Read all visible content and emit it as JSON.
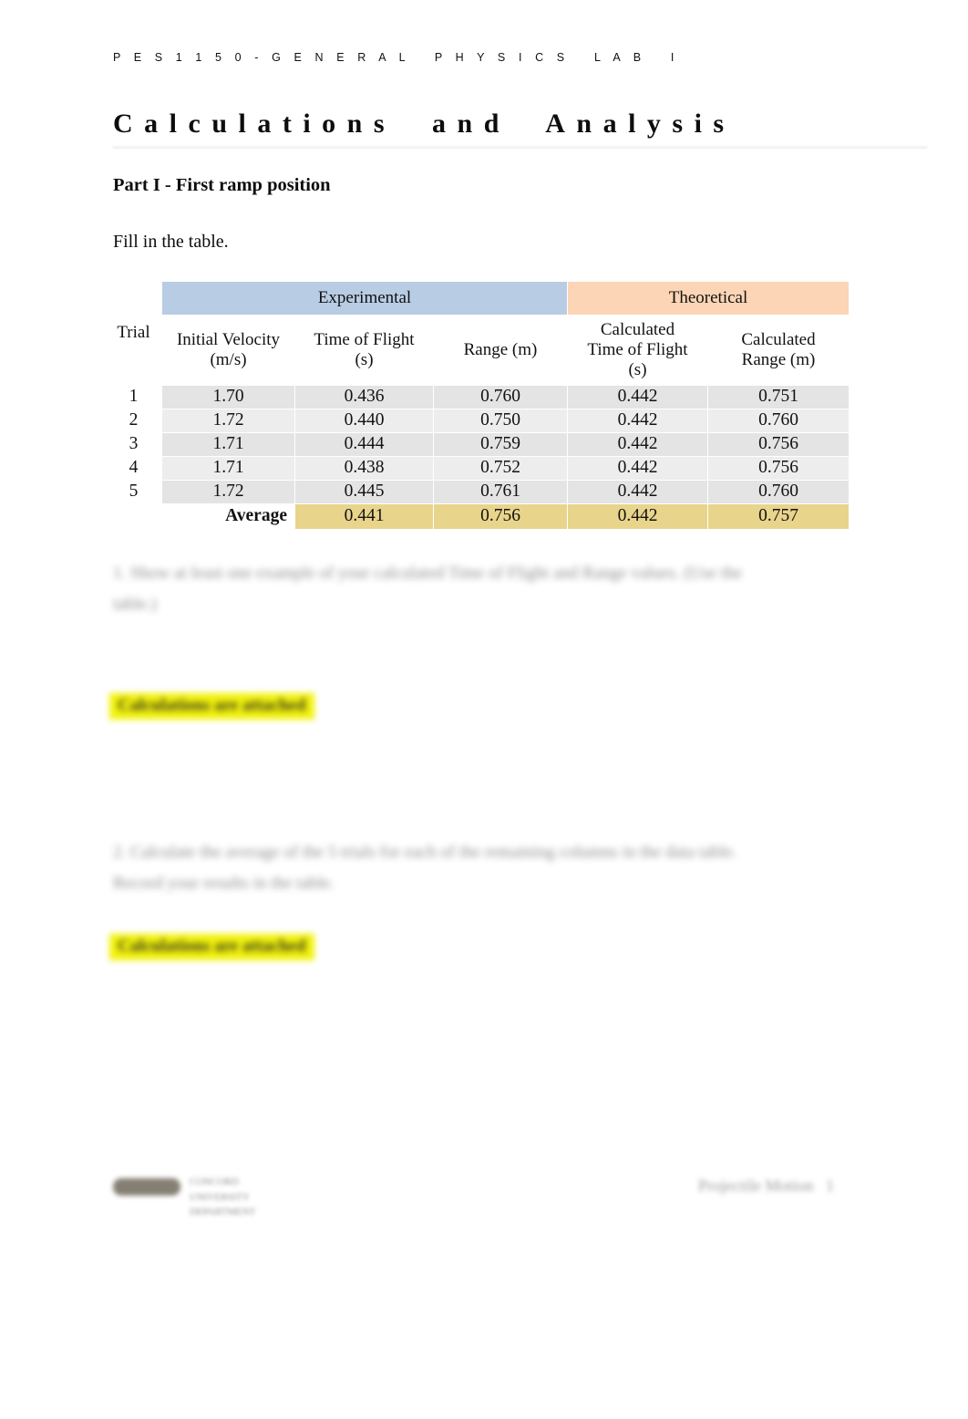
{
  "document": {
    "running_header": "P E S 1 1 5 0 - G E N E R A L   P H Y S I C S   L A B   I",
    "title": "Calculations  and  Analysis",
    "section_heading": "Part I - First ramp position",
    "intro_line": "Fill in the table."
  },
  "table": {
    "group_headers": {
      "trial": "Trial",
      "experimental": "Experimental",
      "theoretical": "Theoretical"
    },
    "column_headers": {
      "initial_velocity": "Initial Velocity\n(m/s)",
      "time_of_flight": "Time of Flight\n(s)",
      "range": "Range (m)",
      "calculated_time_of_flight": "Calculated\nTime of Flight\n(s)",
      "calculated_range": "Calculated\nRange (m)"
    },
    "rows": [
      {
        "trial": "1",
        "initial_velocity": "1.70",
        "time_of_flight": "0.436",
        "range": "0.760",
        "calculated_time_of_flight": "0.442",
        "calculated_range": "0.751"
      },
      {
        "trial": "2",
        "initial_velocity": "1.72",
        "time_of_flight": "0.440",
        "range": "0.750",
        "calculated_time_of_flight": "0.442",
        "calculated_range": "0.760"
      },
      {
        "trial": "3",
        "initial_velocity": "1.71",
        "time_of_flight": "0.444",
        "range": "0.759",
        "calculated_time_of_flight": "0.442",
        "calculated_range": "0.756"
      },
      {
        "trial": "4",
        "initial_velocity": "1.71",
        "time_of_flight": "0.438",
        "range": "0.752",
        "calculated_time_of_flight": "0.442",
        "calculated_range": "0.756"
      },
      {
        "trial": "5",
        "initial_velocity": "1.72",
        "time_of_flight": "0.445",
        "range": "0.761",
        "calculated_time_of_flight": "0.442",
        "calculated_range": "0.760"
      }
    ],
    "average_row": {
      "label": "Average",
      "time_of_flight": "0.441",
      "range": "0.756",
      "calculated_time_of_flight": "0.442",
      "calculated_range": "0.757"
    }
  },
  "questions": [
    {
      "text": "1. Show at least one example of your calculated Time of Flight and Range values. (Use the\n          table.)",
      "answer": "Calculations are attached"
    },
    {
      "text": "2. Calculate the average of the 5 trials for each of the remaining columns in the data table.\n          Record your results in the table.",
      "answer": "Calculations are attached"
    }
  ],
  "footer": {
    "left_text": "CONCORD\nUNIVERSITY\nDEPARTMENT",
    "right_text": "Projectile Motion   1"
  },
  "colors": {
    "experimental_header": "#b8cce4",
    "theoretical_header": "#fbd5b5",
    "average_row": "#e8d48b",
    "data_row": "#e4e4e4",
    "highlight": "#f2f20d"
  }
}
